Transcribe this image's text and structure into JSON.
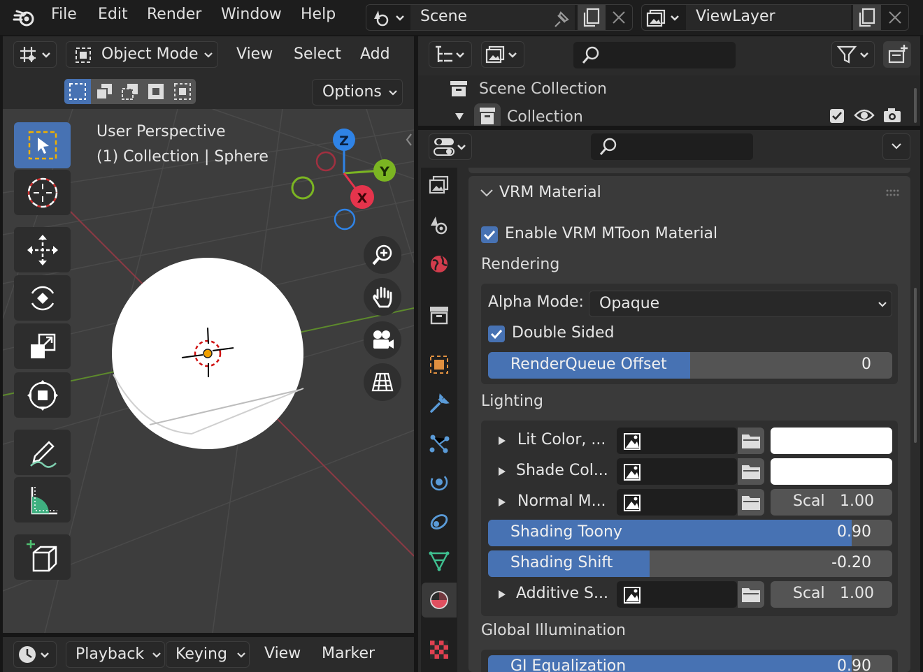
{
  "menubar": {
    "items": [
      "File",
      "Edit",
      "Render",
      "Window",
      "Help"
    ],
    "scene_name": "Scene",
    "viewlayer_name": "ViewLayer"
  },
  "viewport_header": {
    "mode": "Object Mode",
    "menus": [
      "View",
      "Select",
      "Add"
    ],
    "options_label": "Options"
  },
  "viewport": {
    "perspective_label": "User Perspective",
    "object_label": "(1) Collection | Sphere",
    "gizmo_axes": {
      "x": "X",
      "y": "Y",
      "z": "Z"
    }
  },
  "outliner": {
    "scene_collection": "Scene Collection",
    "collection": "Collection"
  },
  "properties": {
    "panel_title": "VRM Material",
    "enable_mtoon_label": "Enable VRM MToon Material",
    "enable_mtoon_checked": true,
    "rendering": {
      "title": "Rendering",
      "alpha_mode_label": "Alpha Mode:",
      "alpha_mode_value": "Opaque",
      "double_sided_label": "Double Sided",
      "double_sided_checked": true,
      "renderqueue_label": "RenderQueue Offset",
      "renderqueue_value": "0",
      "renderqueue_fill": 0.5
    },
    "lighting": {
      "title": "Lighting",
      "lit_color_label": "Lit Color, ...",
      "shade_color_label": "Shade Col...",
      "normal_map_label": "Normal M...",
      "normal_scale_label": "Scal",
      "normal_scale_value": "1.00",
      "shading_toony_label": "Shading Toony",
      "shading_toony_value": "0.90",
      "shading_toony_fill": 0.9,
      "shading_shift_label": "Shading Shift",
      "shading_shift_value": "-0.20",
      "shading_shift_fill": 0.4,
      "additive_label": "Additive S...",
      "additive_scale_label": "Scal",
      "additive_scale_value": "1.00"
    },
    "global_illumination": {
      "title": "Global Illumination",
      "gi_label": "GI Equalization",
      "gi_value": "0.90",
      "gi_fill": 0.9
    }
  },
  "timeline": {
    "menus": [
      "Playback",
      "Keying",
      "View",
      "Marker"
    ]
  },
  "colors": {
    "accent": "#4772b3",
    "axis_x": "#e5344c",
    "axis_y": "#7bb522",
    "axis_z": "#2f83e6"
  }
}
